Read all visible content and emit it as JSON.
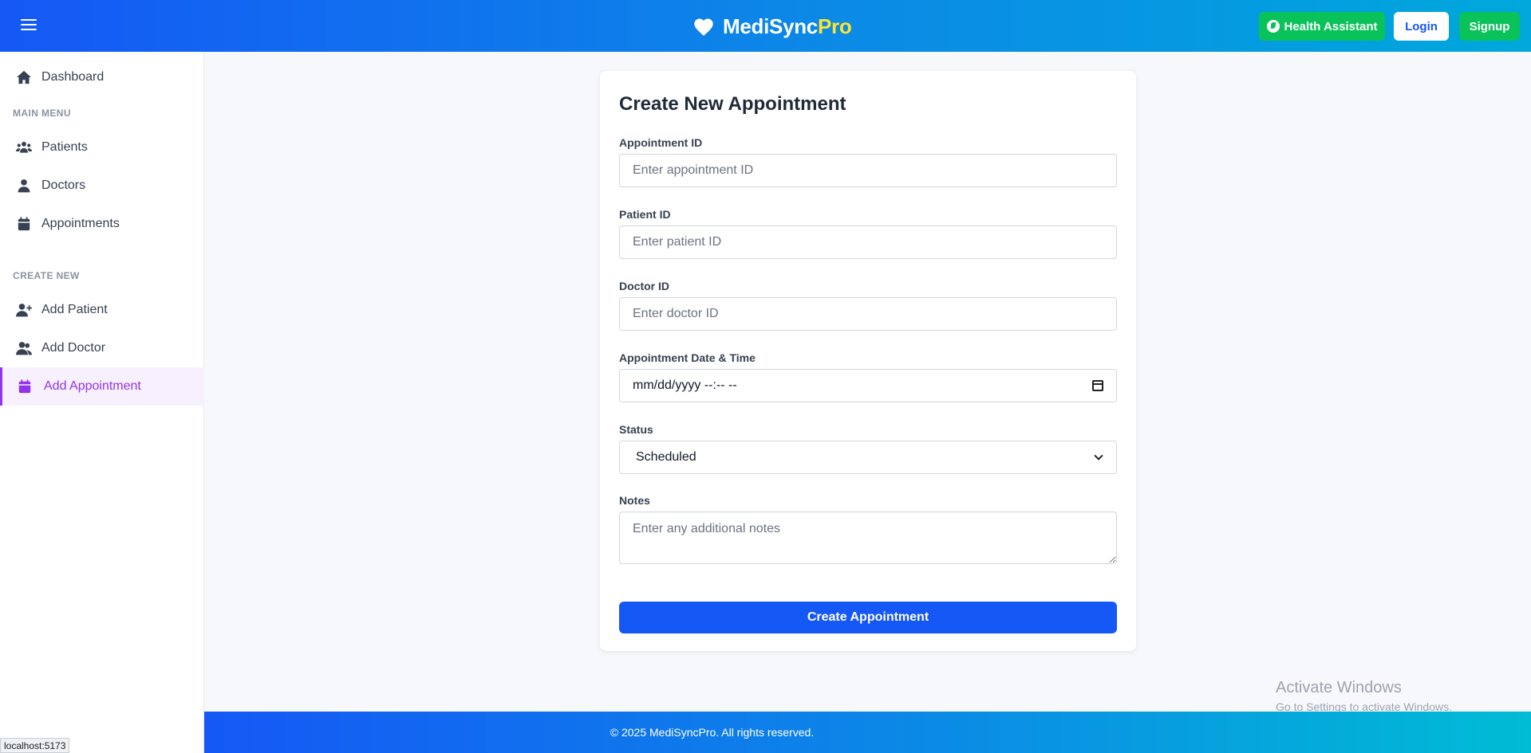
{
  "header": {
    "brand_main": "MediSync",
    "brand_accent": "Pro",
    "health_assistant_label": "Health Assistant",
    "login_label": "Login",
    "signup_label": "Signup"
  },
  "sidebar": {
    "dashboard": "Dashboard",
    "main_menu_label": "MAIN MENU",
    "patients": "Patients",
    "doctors": "Doctors",
    "appointments": "Appointments",
    "create_new_label": "CREATE NEW",
    "add_patient": "Add Patient",
    "add_doctor": "Add Doctor",
    "add_appointment": "Add Appointment",
    "active_color": "#9333ea"
  },
  "form": {
    "title": "Create New Appointment",
    "appointment_id_label": "Appointment ID",
    "appointment_id_placeholder": "Enter appointment ID",
    "patient_id_label": "Patient ID",
    "patient_id_placeholder": "Enter patient ID",
    "doctor_id_label": "Doctor ID",
    "doctor_id_placeholder": "Enter doctor ID",
    "datetime_label": "Appointment Date & Time",
    "datetime_value": "mm/dd/yyyy --:-- --",
    "status_label": "Status",
    "status_value": "Scheduled",
    "notes_label": "Notes",
    "notes_placeholder": "Enter any additional notes",
    "submit_label": "Create Appointment",
    "submit_color": "#1558f5"
  },
  "footer": {
    "text": "© 2025 MediSyncPro. All rights reserved."
  },
  "watermark": {
    "line1": "Activate Windows",
    "line2": "Go to Settings to activate Windows."
  },
  "status_bar": {
    "url": "localhost:5173"
  }
}
